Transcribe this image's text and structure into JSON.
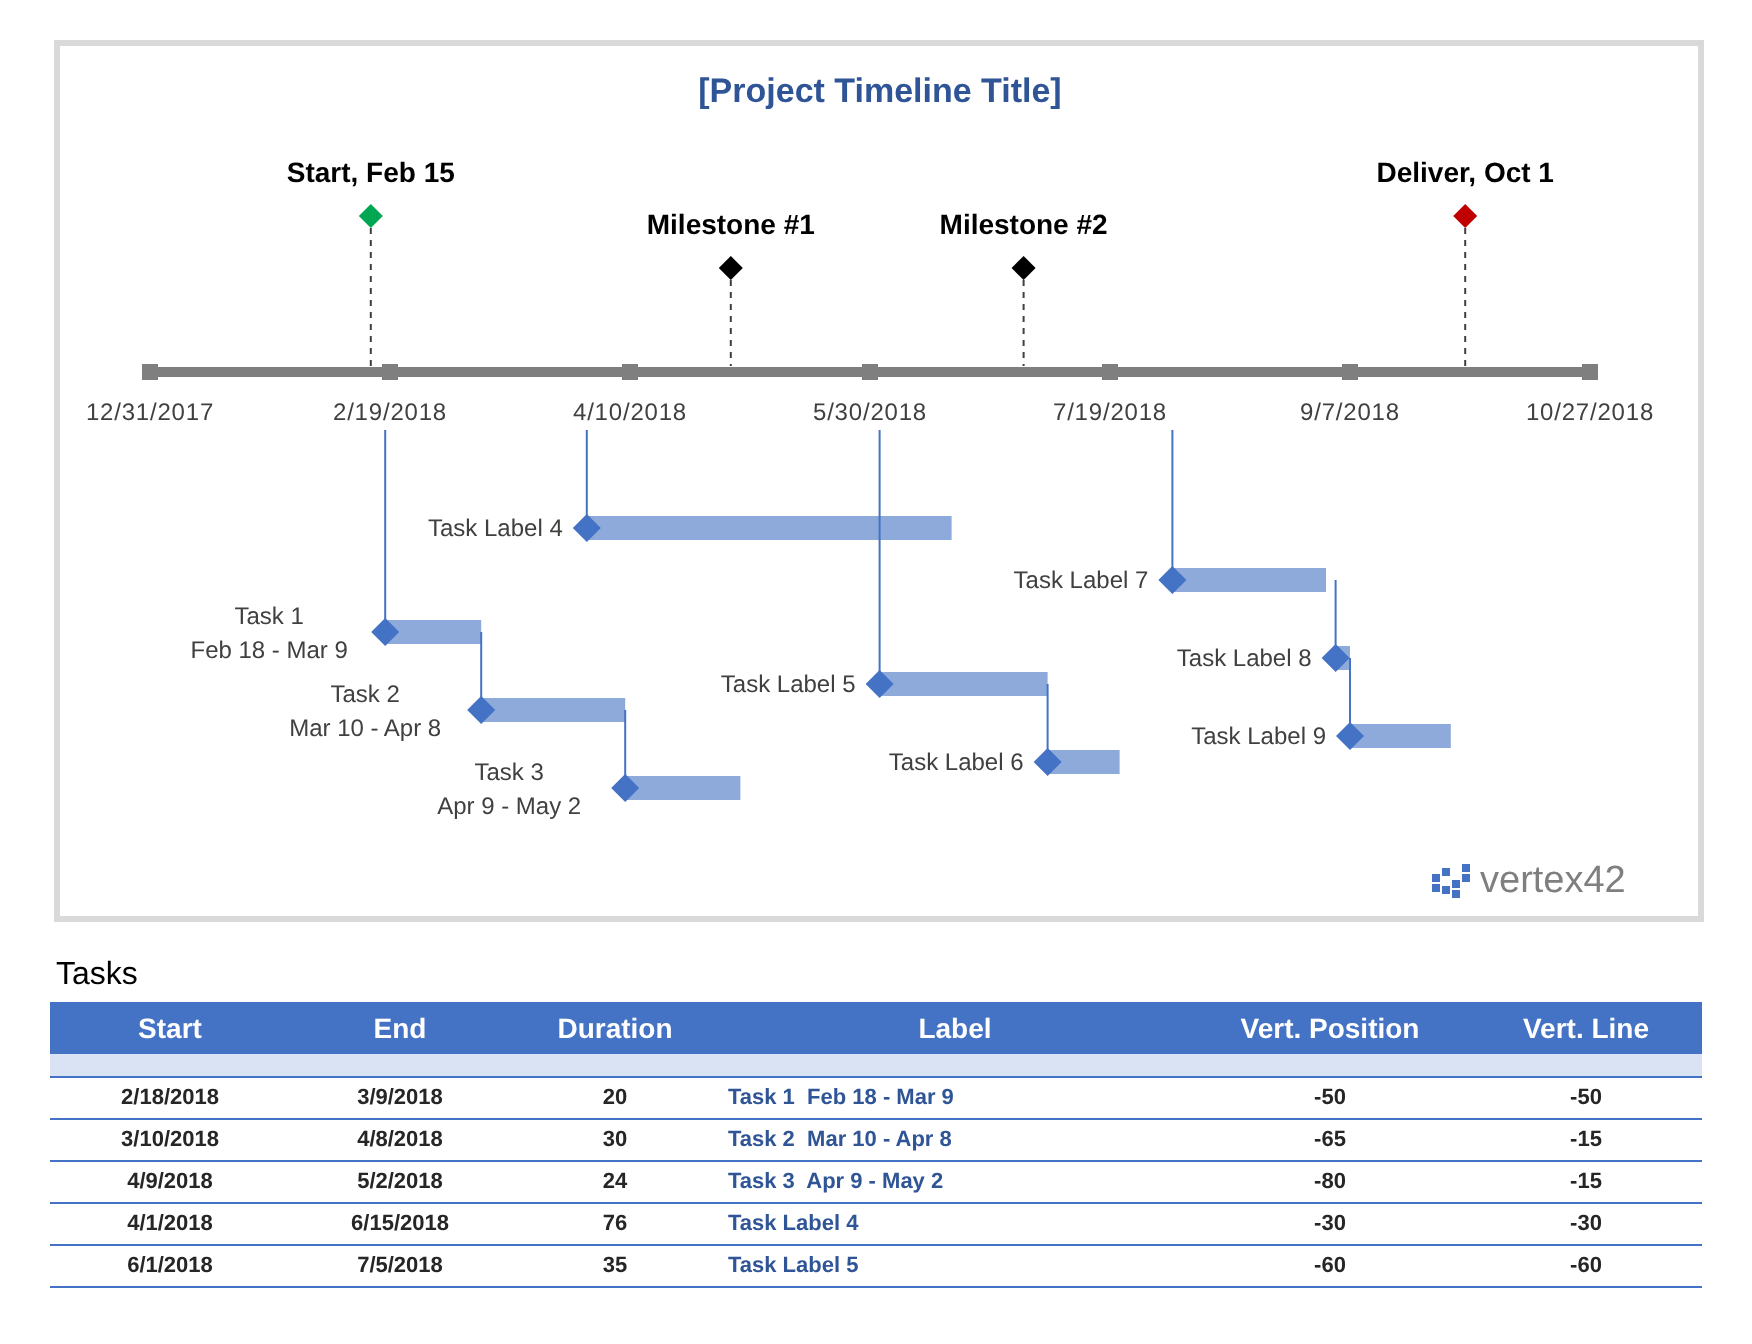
{
  "timeline": {
    "title": "[Project Timeline Title]",
    "logo": "vertex42",
    "axis_labels": [
      "12/31/2017",
      "2/19/2018",
      "4/10/2018",
      "5/30/2018",
      "7/19/2018",
      "9/7/2018",
      "10/27/2018"
    ],
    "milestones": [
      {
        "label": "Start, Feb 15",
        "color": "#00a651"
      },
      {
        "label": "Milestone #1",
        "color": "#000000"
      },
      {
        "label": "Milestone #2",
        "color": "#000000"
      },
      {
        "label": "Deliver, Oct 1",
        "color": "#c00000"
      }
    ],
    "tasks": [
      {
        "label": [
          "Task Label 4"
        ]
      },
      {
        "label": [
          "Task Label 7"
        ]
      },
      {
        "label": [
          "Task 1",
          "Feb 18 - Mar 9"
        ]
      },
      {
        "label": [
          "Task Label 8"
        ]
      },
      {
        "label": [
          "Task Label 5"
        ]
      },
      {
        "label": [
          "Task 2",
          "Mar 10 - Apr 8"
        ]
      },
      {
        "label": [
          "Task Label 9"
        ]
      },
      {
        "label": [
          "Task Label 6"
        ]
      },
      {
        "label": [
          "Task 3",
          "Apr 9 - May 2"
        ]
      }
    ]
  },
  "table": {
    "title": "Tasks",
    "columns": [
      "Start",
      "End",
      "Duration",
      "Label",
      "Vert. Position",
      "Vert. Line"
    ],
    "rows": [
      [
        "2/18/2018",
        "3/9/2018",
        "20",
        "Task 1  Feb 18 - Mar 9",
        "-50",
        "-50"
      ],
      [
        "3/10/2018",
        "4/8/2018",
        "30",
        "Task 2  Mar 10 - Apr 8",
        "-65",
        "-15"
      ],
      [
        "4/9/2018",
        "5/2/2018",
        "24",
        "Task 3  Apr 9 - May 2",
        "-80",
        "-15"
      ],
      [
        "4/1/2018",
        "6/15/2018",
        "76",
        "Task Label 4",
        "-30",
        "-30"
      ],
      [
        "6/1/2018",
        "7/5/2018",
        "35",
        "Task Label 5",
        "-60",
        "-60"
      ]
    ]
  }
}
